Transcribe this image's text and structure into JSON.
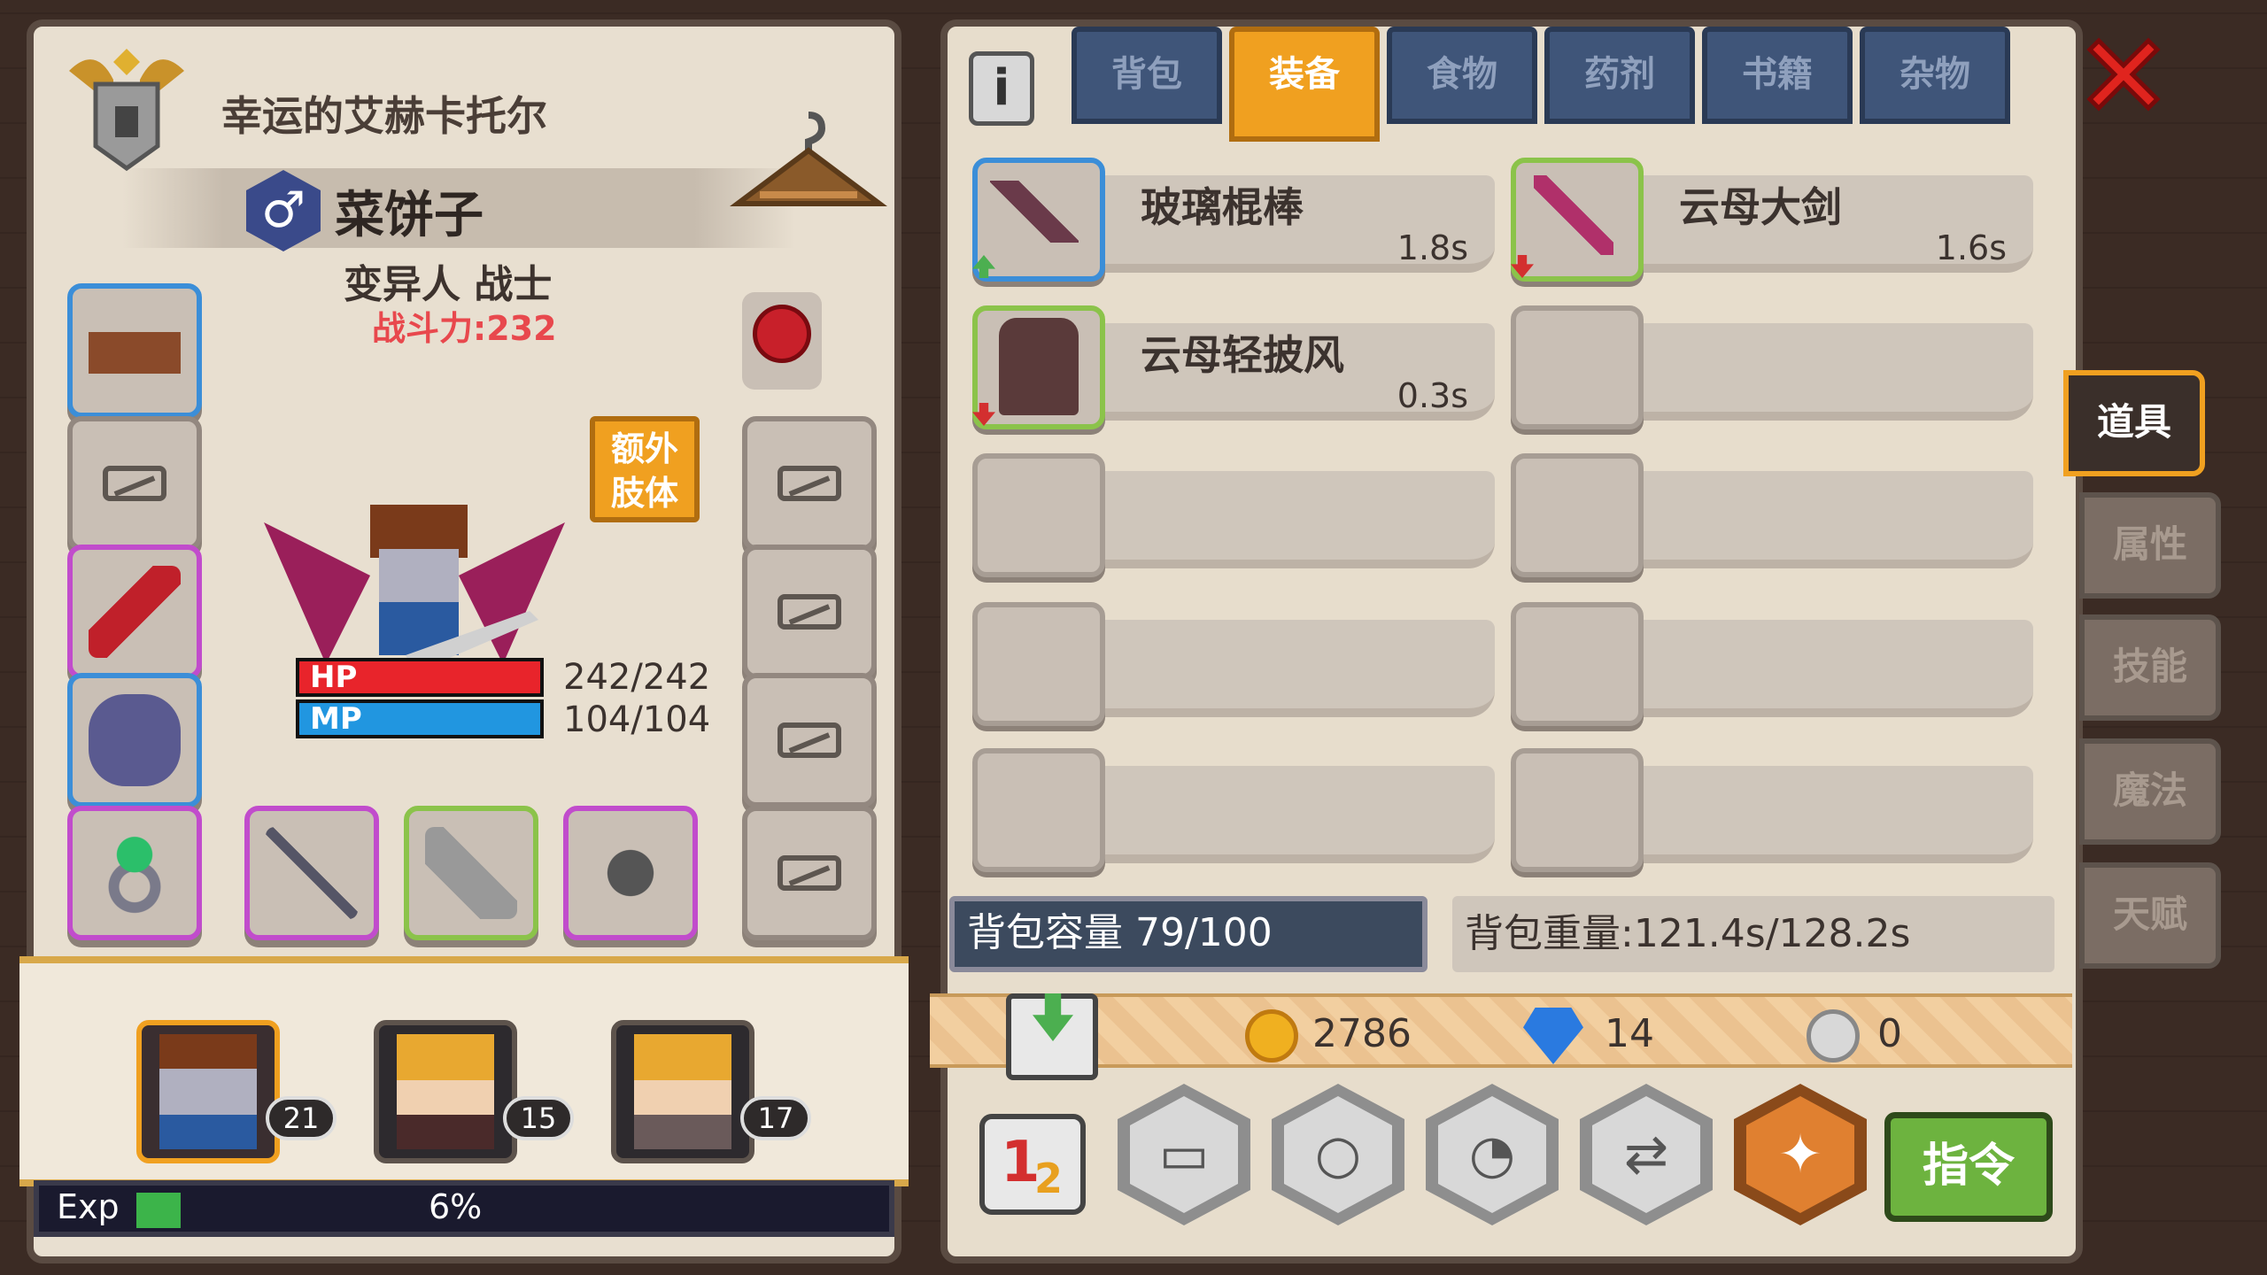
{
  "character": {
    "title": "幸运的艾赫卡托尔",
    "name": "菜饼子",
    "gender_icon": "male-icon",
    "class": "变异人 战士",
    "power": "战斗力:232",
    "hp": "242/242",
    "mp": "104/104",
    "hp_label": "HP",
    "mp_label": "MP",
    "hp_fraction": 1.0,
    "mp_fraction": 1.0,
    "extra_limb_label": "额外肢体"
  },
  "party": [
    {
      "level": "21"
    },
    {
      "level": "15"
    },
    {
      "level": "17"
    }
  ],
  "exp": {
    "label": "Exp",
    "percent_text": "6%",
    "fraction": 0.06
  },
  "tabs": [
    {
      "label": "背包"
    },
    {
      "label": "装备"
    },
    {
      "label": "食物"
    },
    {
      "label": "药剂"
    },
    {
      "label": "书籍"
    },
    {
      "label": "杂物"
    }
  ],
  "active_tab": "装备",
  "equipment": [
    {
      "name": "玻璃棍棒",
      "weight": "1.8s"
    },
    {
      "name": "云母大剑",
      "weight": "1.6s"
    },
    {
      "name": "云母轻披风",
      "weight": "0.3s"
    },
    {
      "name": "",
      "weight": ""
    }
  ],
  "bag": {
    "capacity": "背包容量 79/100",
    "weight": "背包重量:121.4s/128.2s"
  },
  "currency": {
    "gold": "2786",
    "gems": "14",
    "silver": "0"
  },
  "side_tabs": [
    {
      "label": "道具"
    },
    {
      "label": "属性"
    },
    {
      "label": "技能"
    },
    {
      "label": "魔法"
    },
    {
      "label": "天赋"
    }
  ],
  "command_button": "指令",
  "colors": {
    "hp": "#e8242b",
    "mp": "#2196e0",
    "active_tab": "#f0a020",
    "close": "#e0241e",
    "command": "#6db33f"
  }
}
